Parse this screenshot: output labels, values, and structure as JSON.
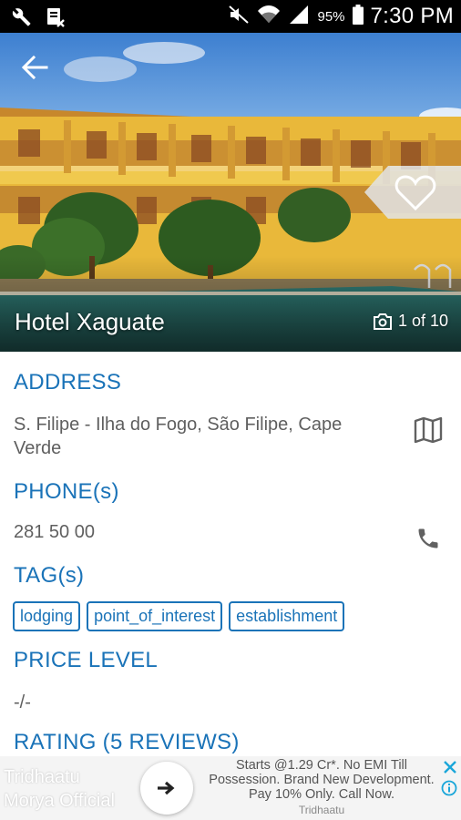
{
  "status_bar": {
    "battery": "95%",
    "time": "7:30 PM"
  },
  "hero": {
    "hotel_name": "Hotel Xaguate",
    "photo_counter": "1 of 10"
  },
  "address": {
    "title": "ADDRESS",
    "line1": "S. Filipe - Ilha do Fogo, São Filipe, Cape",
    "line2": "Verde"
  },
  "phone": {
    "title": "PHONE(s)",
    "value": "281 50 00"
  },
  "tags": {
    "title": "TAG(s)",
    "items": [
      "lodging",
      "point_of_interest",
      "establishment"
    ]
  },
  "price": {
    "title": "PRICE LEVEL",
    "value": "-/-"
  },
  "rating": {
    "title": "RATING (5 REVIEWS)"
  },
  "ad": {
    "brand_line1": "Tridhaatu",
    "brand_line2": "Morya Official",
    "text_line1": "Starts @1.29 Cr*. No EMI Till",
    "text_line2": "Possession. Brand New Development.",
    "text_line3": "Pay 10% Only. Call Now.",
    "sponsor": "Tridhaatu"
  },
  "colors": {
    "accent": "#1a73b8",
    "text_gray": "#5f5f5f",
    "status_bar": "#000000"
  },
  "icons": [
    "wrench-icon",
    "clipboard-x-icon",
    "mute-icon",
    "wifi-icon",
    "signal-icon",
    "battery-icon",
    "back-arrow-icon",
    "heart-icon",
    "camera-icon",
    "map-icon",
    "phone-icon",
    "arrow-right-icon",
    "close-icon",
    "info-icon"
  ]
}
